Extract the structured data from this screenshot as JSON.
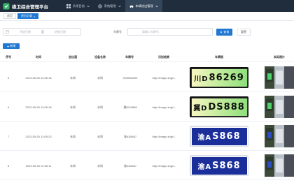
{
  "app": {
    "title": "缘卫综合管理平台"
  },
  "menu": [
    {
      "label": "仿项目档",
      "icon": "grid-icon",
      "active": false
    },
    {
      "label": "系统管理",
      "icon": "gear-icon",
      "active": false
    },
    {
      "label": "车辆进出管理",
      "icon": "car-icon",
      "active": true
    }
  ],
  "tabs": [
    {
      "label": "首页",
      "active": false
    },
    {
      "label": "进出记录",
      "active": true
    }
  ],
  "filter": {
    "start_placeholder": "开始日期",
    "range_separator": "至",
    "end_placeholder": "结束日期",
    "plate_label": "车牌号",
    "plate_placeholder": "请输入车牌号",
    "query_label": "查询",
    "reset_label": "重置"
  },
  "add_label": "新增",
  "table": {
    "headers": [
      "序号",
      "时间",
      "进出通",
      "设备名称",
      "车牌号",
      "识别结果",
      "车牌图",
      "实际照片"
    ],
    "rows": [
      {
        "no": "5",
        "time": "2023-05-30 12:05:18",
        "channel": "未知",
        "device": "未知",
        "plate_no": "川D86269D",
        "url": "http://image.zhgl.t...",
        "plate_color": "green",
        "plate_prov": "川D",
        "plate_text": "86269"
      },
      {
        "no": "6",
        "time": "2023-05-30 12:05:18",
        "channel": "未知",
        "device": "未知",
        "plate_no": "冀DDS888",
        "url": "http://image.zhgl.t...",
        "plate_color": "green",
        "plate_prov": "冀D",
        "plate_text": "DS888"
      },
      {
        "no": "7",
        "time": "2023-05-30 12:05:23",
        "channel": "未知",
        "device": "未知",
        "plate_no": "渝AS8687",
        "url": "http://image.zhgl.t...",
        "plate_color": "blue",
        "plate_prov": "渝A",
        "plate_text": "S868"
      },
      {
        "no": "8",
        "time": "2023-05-30 12:05:11",
        "channel": "未知",
        "device": "未知",
        "plate_no": "渝AS8687",
        "url": "http://image.zhgl.t...",
        "plate_color": "blue",
        "plate_prov": "渝A",
        "plate_text": "S868"
      }
    ]
  },
  "colors": {
    "topbar": "#1f2d3d",
    "primary": "#1f78d1",
    "plate_blue": "#1a2f9a",
    "plate_green": "#8ee07a"
  }
}
